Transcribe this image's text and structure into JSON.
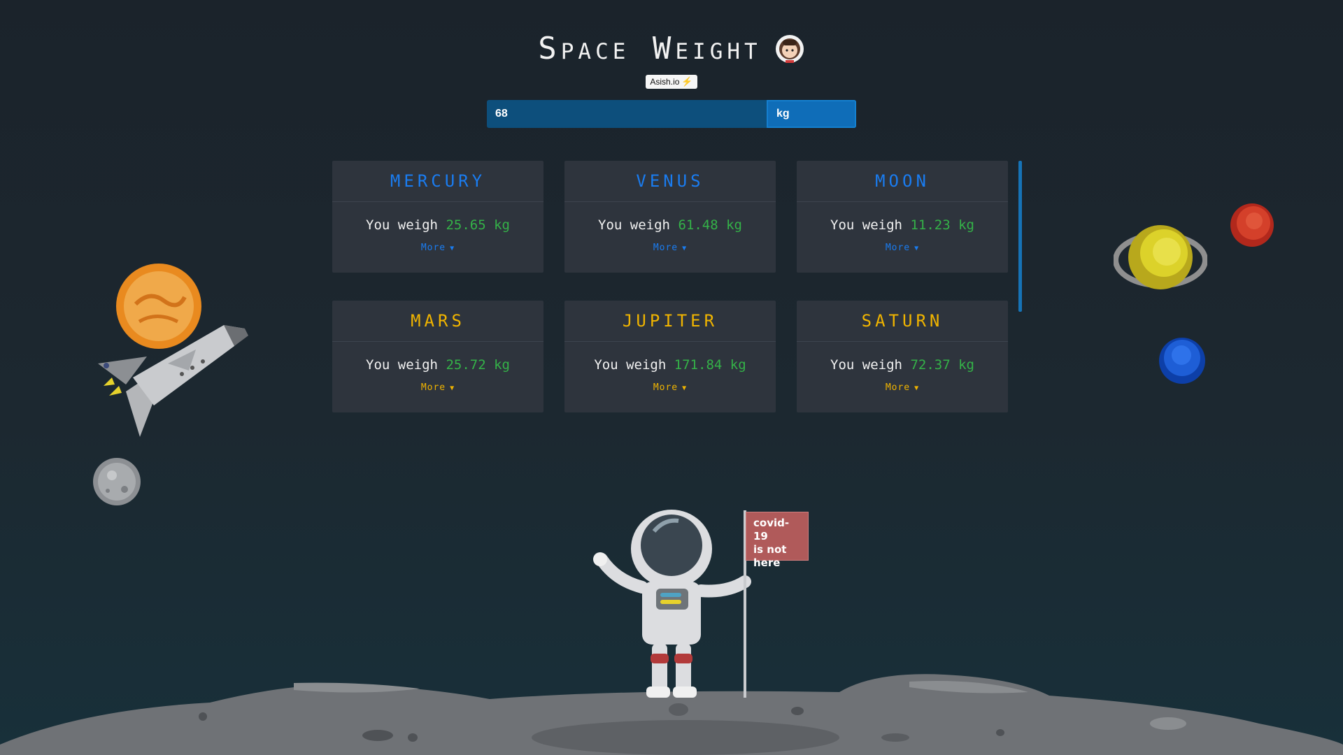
{
  "header": {
    "title": "Space Weight",
    "badge_label": "Asish.io",
    "badge_icon": "bolt-icon"
  },
  "weight_input": {
    "value": "68",
    "unit": "kg"
  },
  "planets": [
    {
      "name": "MERCURY",
      "prefix": "You weigh",
      "value": "25.65 kg",
      "more": "More",
      "color": "#1a7cf0"
    },
    {
      "name": "VENUS",
      "prefix": "You weigh",
      "value": "61.48 kg",
      "more": "More",
      "color": "#1a7cf0"
    },
    {
      "name": "MOON",
      "prefix": "You weigh",
      "value": "11.23 kg",
      "more": "More",
      "color": "#1a7cf0"
    },
    {
      "name": "MARS",
      "prefix": "You weigh",
      "value": "25.72 kg",
      "more": "More",
      "color": "#f0b400"
    },
    {
      "name": "JUPITER",
      "prefix": "You weigh",
      "value": "171.84 kg",
      "more": "More",
      "color": "#f0b400"
    },
    {
      "name": "SATURN",
      "prefix": "You weigh",
      "value": "72.37 kg",
      "more": "More",
      "color": "#f0b400"
    }
  ],
  "flag": {
    "line1": "covid-19",
    "line2": "is not",
    "line3": "here"
  },
  "colors": {
    "weight_value": "#34b248",
    "accent_blue": "#1a7cf0",
    "accent_gold": "#f0b400"
  }
}
